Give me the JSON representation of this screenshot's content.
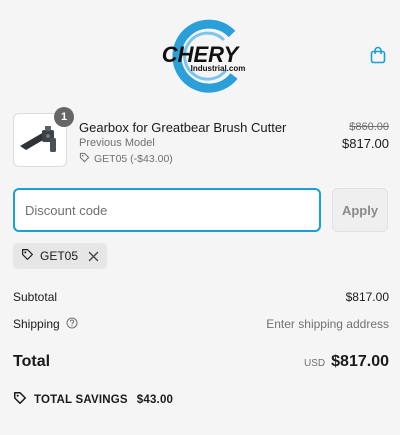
{
  "header": {
    "logo_text": "CHERY",
    "logo_subtext": "Industrial.com",
    "cart_icon": "shopping-bag-icon"
  },
  "line_item": {
    "quantity": "1",
    "title": "Gearbox for Greatbear Brush Cutter",
    "variant": "Previous Model",
    "discount_label": "GET05 (-$43.00)",
    "compare_price": "$860.00",
    "price": "$817.00",
    "image_icon": "gearbox-image"
  },
  "discount": {
    "placeholder": "Discount code",
    "value": "",
    "apply_label": "Apply"
  },
  "applied_code": {
    "code": "GET05",
    "tag_icon": "tag-icon",
    "remove_icon": "close-icon"
  },
  "summary": {
    "subtotal_label": "Subtotal",
    "subtotal_value": "$817.00",
    "shipping_label": "Shipping",
    "shipping_value": "Enter shipping address",
    "total_label": "Total",
    "currency": "USD",
    "total_value": "$817.00"
  },
  "savings": {
    "label": "TOTAL SAVINGS",
    "amount": "$43.00"
  },
  "colors": {
    "accent": "#1a9fd6",
    "logo_blue": "#2a9fd8",
    "background": "#f5f5f5"
  }
}
